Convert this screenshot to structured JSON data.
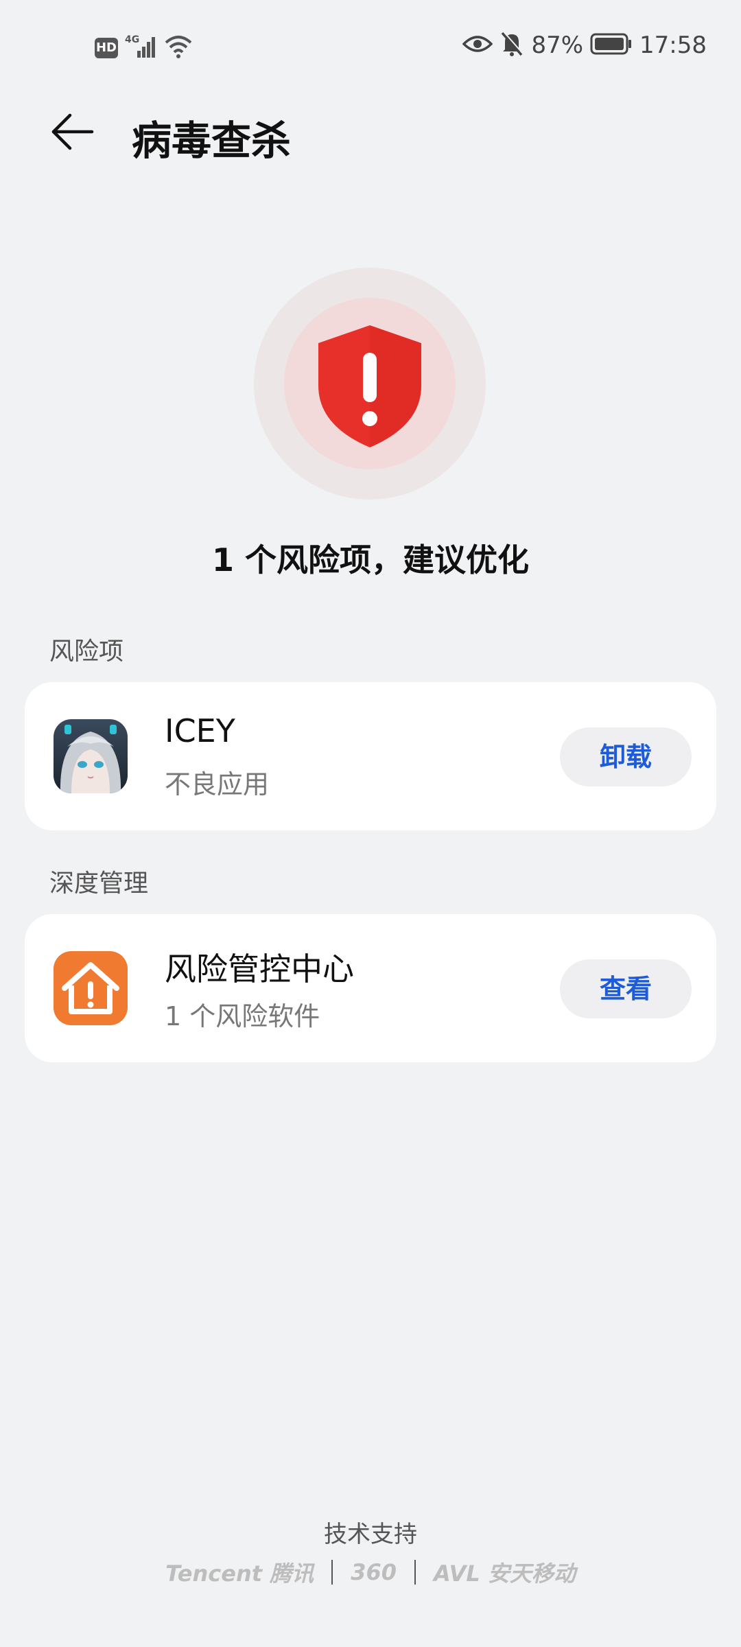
{
  "status_bar": {
    "hd": "HD",
    "network": "4G",
    "battery_percent": "87%",
    "time": "17:58"
  },
  "header": {
    "title": "病毒查杀"
  },
  "summary": {
    "text": "1 个风险项，建议优化"
  },
  "risk_section": {
    "label": "风险项",
    "item": {
      "name": "ICEY",
      "subtitle": "不良应用",
      "action": "卸载"
    }
  },
  "deep_section": {
    "label": "深度管理",
    "item": {
      "name": "风险管控中心",
      "subtitle": "1 个风险软件",
      "action": "查看"
    }
  },
  "footer": {
    "label": "技术支持",
    "logos": [
      "Tencent 腾讯",
      "360",
      "AVL 安天移动"
    ]
  },
  "colors": {
    "accent": "#1E5BD6",
    "danger": "#E8302A",
    "background": "#F1F2F4",
    "app_orange": "#F07A30"
  }
}
